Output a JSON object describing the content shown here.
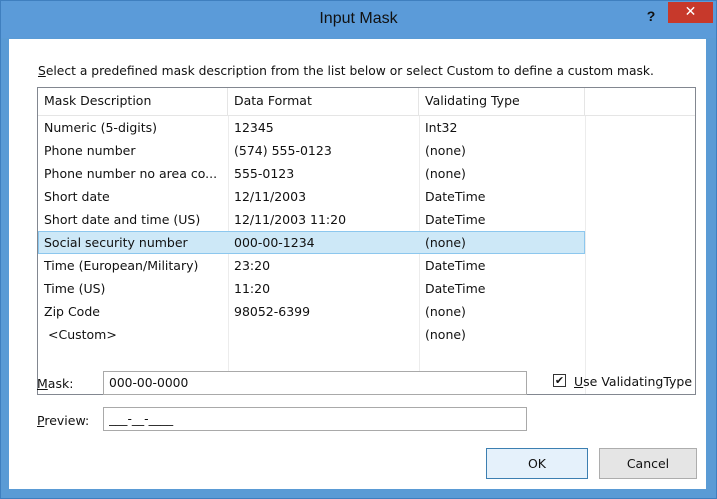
{
  "window": {
    "title": "Input Mask",
    "help_glyph": "?",
    "close_glyph": "✕"
  },
  "instruction": {
    "accesskey": "S",
    "rest": "elect a predefined mask description from the list below or select Custom to define a custom mask."
  },
  "list": {
    "headers": [
      "Mask Description",
      "Data Format",
      "Validating Type"
    ],
    "rows": [
      {
        "description": "Numeric (5-digits)",
        "format": "12345",
        "type": "Int32"
      },
      {
        "description": "Phone number",
        "format": "(574) 555-0123",
        "type": "(none)"
      },
      {
        "description": "Phone number no area co...",
        "format": "555-0123",
        "type": "(none)"
      },
      {
        "description": "Short date",
        "format": "12/11/2003",
        "type": "DateTime"
      },
      {
        "description": "Short date and time (US)",
        "format": "12/11/2003 11:20",
        "type": "DateTime"
      },
      {
        "description": "Social security number",
        "format": "000-00-1234",
        "type": "(none)"
      },
      {
        "description": "Time (European/Military)",
        "format": "23:20",
        "type": "DateTime"
      },
      {
        "description": "Time (US)",
        "format": "11:20",
        "type": "DateTime"
      },
      {
        "description": "Zip Code",
        "format": "98052-6399",
        "type": "(none)"
      },
      {
        "description": "<Custom>",
        "format": "",
        "type": "(none)"
      }
    ],
    "selected_row": 5
  },
  "mask": {
    "label_accesskey": "M",
    "label_rest": "ask:",
    "value": "000-00-0000"
  },
  "preview": {
    "label_accesskey": "P",
    "label_rest": "review:",
    "value": "___-__-____"
  },
  "use_validating_type": {
    "checked": true,
    "check_glyph": "✔",
    "label_accesskey": "U",
    "label_rest": "se ValidatingType"
  },
  "buttons": {
    "ok": "OK",
    "cancel": "Cancel"
  }
}
